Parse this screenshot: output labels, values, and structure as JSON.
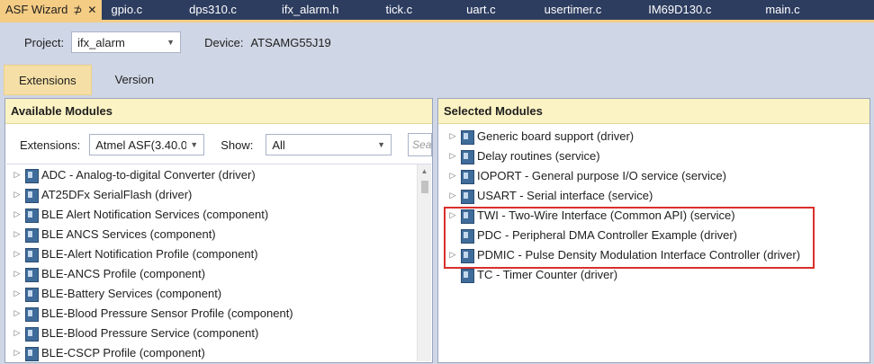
{
  "tabs": [
    {
      "label": "ASF Wizard",
      "active": true
    },
    {
      "label": "gpio.c"
    },
    {
      "label": "dps310.c"
    },
    {
      "label": "ifx_alarm.h"
    },
    {
      "label": "tick.c"
    },
    {
      "label": "uart.c"
    },
    {
      "label": "usertimer.c"
    },
    {
      "label": "IM69D130.c"
    },
    {
      "label": "main.c"
    }
  ],
  "tab_icons": {
    "pin": "pin-icon",
    "close": "close-icon"
  },
  "project": {
    "label": "Project:",
    "value": "ifx_alarm"
  },
  "device": {
    "label": "Device:",
    "value": "ATSAMG55J19"
  },
  "view_tabs": {
    "extensions": "Extensions",
    "version": "Version"
  },
  "available": {
    "title": "Available Modules",
    "extensions_label": "Extensions:",
    "extensions_value": "Atmel ASF(3.40.0)",
    "show_label": "Show:",
    "show_value": "All",
    "search_placeholder": "Sea",
    "items": [
      "ADC - Analog-to-digital Converter (driver)",
      "AT25DFx SerialFlash (driver)",
      "BLE Alert Notification Services (component)",
      "BLE ANCS Services (component)",
      "BLE-Alert Notification Profile (component)",
      "BLE-ANCS Profile (component)",
      "BLE-Battery Services (component)",
      "BLE-Blood Pressure Sensor Profile (component)",
      "BLE-Blood Pressure Service (component)",
      "BLE-CSCP Profile (component)"
    ]
  },
  "selected": {
    "title": "Selected Modules",
    "items": [
      {
        "label": "Generic board support (driver)",
        "expandable": true
      },
      {
        "label": "Delay routines (service)",
        "expandable": true
      },
      {
        "label": "IOPORT - General purpose I/O service (service)",
        "expandable": true
      },
      {
        "label": "USART - Serial interface (service)",
        "expandable": true
      },
      {
        "label": "TWI - Two-Wire Interface (Common API) (service)",
        "expandable": true
      },
      {
        "label": "PDC - Peripheral DMA Controller Example (driver)",
        "expandable": false
      },
      {
        "label": "PDMIC - Pulse Density Modulation Interface Controller (driver)",
        "expandable": true
      },
      {
        "label": "TC - Timer Counter (driver)",
        "expandable": false
      }
    ]
  },
  "colors": {
    "tab_bar": "#2d3d60",
    "active_tab": "#f5cc84",
    "panel_header": "#fcf3c4",
    "highlight": "#d9302c"
  }
}
